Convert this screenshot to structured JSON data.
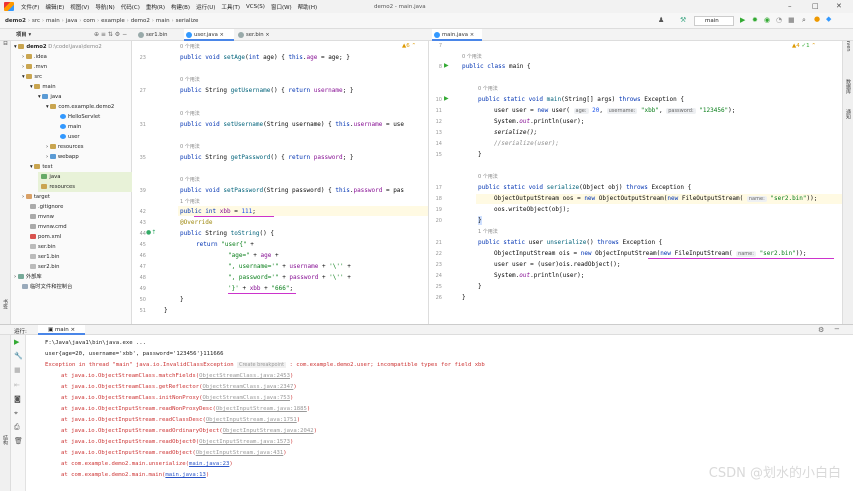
{
  "menubar": {
    "items": [
      "文件(F)",
      "编辑(E)",
      "视图(V)",
      "导航(N)",
      "代码(C)",
      "重构(R)",
      "构建(B)",
      "运行(U)",
      "工具(T)",
      "VCS(S)",
      "窗口(W)",
      "帮助(H)"
    ],
    "window_title": "demo2 - main.java"
  },
  "navbar": {
    "breadcrumbs": [
      "demo2",
      "src",
      "main",
      "java",
      "com",
      "example",
      "demo2",
      "main",
      "serialize"
    ],
    "run_config": "main"
  },
  "project": {
    "header": "项目",
    "tabs": [
      "ser1.bin",
      "user.java",
      "ser.bin"
    ],
    "root": "demo2",
    "root_path": "D:\\code\\java\\demo2",
    "items": [
      ".idea",
      ".mvn",
      "src",
      "main",
      "java",
      "com.example.demo2",
      "HelloServlet",
      "main",
      "user",
      "resources",
      "webapp",
      "test",
      "java",
      "resources",
      "target",
      ".gitignore",
      "mvnw",
      "mvnw.cmd",
      "pom.xml",
      "ser.bin",
      "ser1.bin",
      "ser2.bin",
      "外部库",
      "临时文件和控制台"
    ]
  },
  "editor_left": {
    "tab": "user.java",
    "warn_count": "6",
    "usage_hint": "0 个用法",
    "usage_hint_one": "1 个用法",
    "line_numbers": [
      "23",
      "27",
      "31",
      "35",
      "39",
      "42",
      "43",
      "44",
      "45",
      "46",
      "47",
      "48",
      "49",
      "50",
      "51"
    ],
    "code": {
      "setAge": "public void setAge(int age) { this.age = age; }",
      "getUsername": "public String getUsername() { return username; }",
      "setUsername": "public void setUsername(String username) { this.username = use",
      "getPassword": "public String getPassword() { return password; }",
      "setPassword": "public void setPassword(String password) { this.password = pas",
      "xbb": "public int xbb = 111;",
      "override": "@Override",
      "toString": "public String toString() {",
      "ret": "return \"user{\" +",
      "l1": "\"age=\" + age +",
      "l2": "\", username='\" + username + '\\'' +",
      "l3": "\", password='\" + password + '\\'' +",
      "l4": "'}' + xbb + \"666\";",
      "close1": "}",
      "close2": "}"
    }
  },
  "editor_right": {
    "tab": "main.java",
    "warn_count": "4",
    "ok_count": "1",
    "usage_hint": "0 个用法",
    "usage_hint_one": "1 个用法",
    "line_numbers": [
      "7",
      "8",
      "9",
      "10",
      "11",
      "12",
      "13",
      "14",
      "15",
      "16",
      "17",
      "18",
      "19",
      "20",
      "21",
      "22",
      "23",
      "24",
      "25",
      "26"
    ],
    "code": {
      "classDecl": "public class main {",
      "mainDecl": "public static void main(String[] args) throws Exception {",
      "newUser": "user user = new user(",
      "hint_age": "age:",
      "v20": "20,",
      "hint_username": "username:",
      "vxbb": "\"xbb\",",
      "hint_password": "password:",
      "vpwd": "\"123456\");",
      "println": "System.out.println(user);",
      "serializeCall": "serialize();",
      "unserializeCall": "//serialize(user);",
      "serializeDecl": "public static void serialize(Object obj) throws Exception {",
      "oos": "ObjectOutputStream oos = new ObjectOutputStream(new FileOutputStream(",
      "hint_name": "name:",
      "ser2": "\"ser2.bin\"));",
      "write": "oos.writeObject(obj);",
      "unserDecl": "public static user unserialize() throws Exception {",
      "ois": "ObjectInputStream ois = new ObjectInputStream(new FileInputStream(",
      "ser2b": "\"ser2.bin\"));",
      "read": "user user = (user)ois.readObject();",
      "println2": "System.out.println(user);",
      "brace": "}"
    }
  },
  "run_panel": {
    "label": "运行:",
    "tab": "main",
    "lines": {
      "cmd": "F:\\Java\\java1\\bin\\java.exe ...",
      "out": "user{age=20, username='xbb', password='123456'}111666",
      "exc_a": "Exception in thread \"main\" java.io.InvalidClassException",
      "exc_tip": "Create breakpoint",
      "exc_b": ": com.example.demo2.user; incompatible types for field xbb"
    },
    "stack": [
      {
        "at": "at java.io.ObjectStreamClass.matchFields(",
        "loc": "ObjectStreamClass.java:2453",
        "link": false
      },
      {
        "at": "at java.io.ObjectStreamClass.getReflector(",
        "loc": "ObjectStreamClass.java:2347",
        "link": false
      },
      {
        "at": "at java.io.ObjectStreamClass.initNonProxy(",
        "loc": "ObjectStreamClass.java:753",
        "link": false
      },
      {
        "at": "at java.io.ObjectInputStream.readNonProxyDesc(",
        "loc": "ObjectInputStream.java:1885",
        "link": false
      },
      {
        "at": "at java.io.ObjectInputStream.readClassDesc(",
        "loc": "ObjectInputStream.java:1751",
        "link": false
      },
      {
        "at": "at java.io.ObjectInputStream.readOrdinaryObject(",
        "loc": "ObjectInputStream.java:2042",
        "link": false
      },
      {
        "at": "at java.io.ObjectInputStream.readObject0(",
        "loc": "ObjectInputStream.java:1573",
        "link": false
      },
      {
        "at": "at java.io.ObjectInputStream.readObject(",
        "loc": "ObjectInputStream.java:431",
        "link": false
      },
      {
        "at": "at com.example.demo2.main.unserialize(",
        "loc": "main.java:23",
        "link": true
      },
      {
        "at": "at com.example.demo2.main.main(",
        "loc": "main.java:13",
        "link": true
      }
    ]
  },
  "watermark": "CSDN @划水的小白白",
  "colors": {
    "accent": "#4a86e8",
    "error": "#cc3333",
    "link": "#2a54c7",
    "keyword": "#0033b3"
  }
}
